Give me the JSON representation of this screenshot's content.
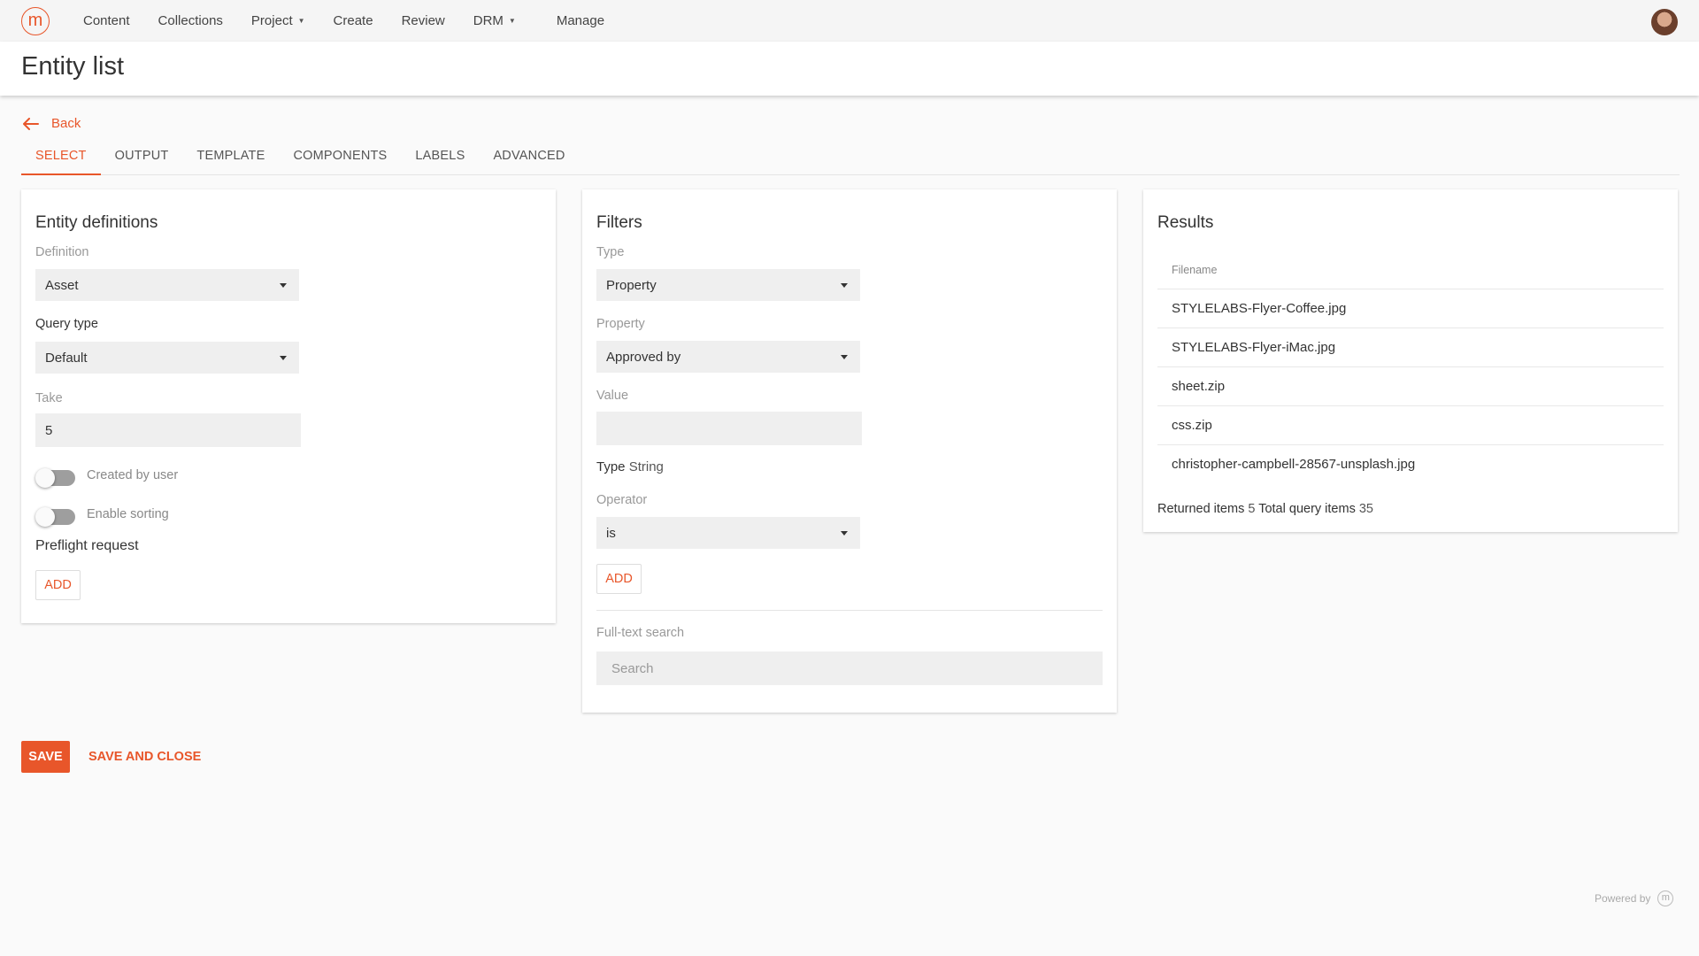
{
  "nav": {
    "logo_letter": "m",
    "items": [
      {
        "label": "Content",
        "dropdown": false
      },
      {
        "label": "Collections",
        "dropdown": false
      },
      {
        "label": "Project",
        "dropdown": true
      },
      {
        "label": "Create",
        "dropdown": false
      },
      {
        "label": "Review",
        "dropdown": false
      },
      {
        "label": "DRM",
        "dropdown": true
      },
      {
        "label": "Manage",
        "dropdown": false
      }
    ]
  },
  "page": {
    "title": "Entity list",
    "back_label": "Back"
  },
  "tabs": [
    {
      "label": "SELECT",
      "active": true
    },
    {
      "label": "OUTPUT",
      "active": false
    },
    {
      "label": "TEMPLATE",
      "active": false
    },
    {
      "label": "COMPONENTS",
      "active": false
    },
    {
      "label": "LABELS",
      "active": false
    },
    {
      "label": "ADVANCED",
      "active": false
    }
  ],
  "entity_definitions": {
    "title": "Entity definitions",
    "definition_label": "Definition",
    "definition_value": "Asset",
    "query_type_label": "Query type",
    "query_type_value": "Default",
    "take_label": "Take",
    "take_value": "5",
    "created_by_user_label": "Created by user",
    "created_by_user_on": false,
    "enable_sorting_label": "Enable sorting",
    "enable_sorting_on": false,
    "preflight_label": "Preflight request",
    "add_label": "ADD"
  },
  "filters": {
    "title": "Filters",
    "type_label": "Type",
    "type_value": "Property",
    "property_label": "Property",
    "property_value": "Approved by",
    "value_label": "Value",
    "value_value": "",
    "type_info_label": "Type",
    "type_info_value": "String",
    "operator_label": "Operator",
    "operator_value": "is",
    "add_label": "ADD",
    "fulltext_label": "Full-text search",
    "fulltext_placeholder": "Search"
  },
  "results": {
    "title": "Results",
    "column_header": "Filename",
    "rows": [
      "STYLELABS-Flyer-Coffee.jpg",
      "STYLELABS-Flyer-iMac.jpg",
      "sheet.zip",
      "css.zip",
      "christopher-campbell-28567-unsplash.jpg"
    ],
    "returned_label": "Returned items",
    "returned_value": "5",
    "total_label": "Total query items",
    "total_value": "35"
  },
  "actions": {
    "save_label": "SAVE",
    "save_close_label": "SAVE AND CLOSE"
  },
  "footer": {
    "powered_label": "Powered by",
    "logo_letter": "m"
  },
  "colors": {
    "accent": "#e8562a"
  }
}
